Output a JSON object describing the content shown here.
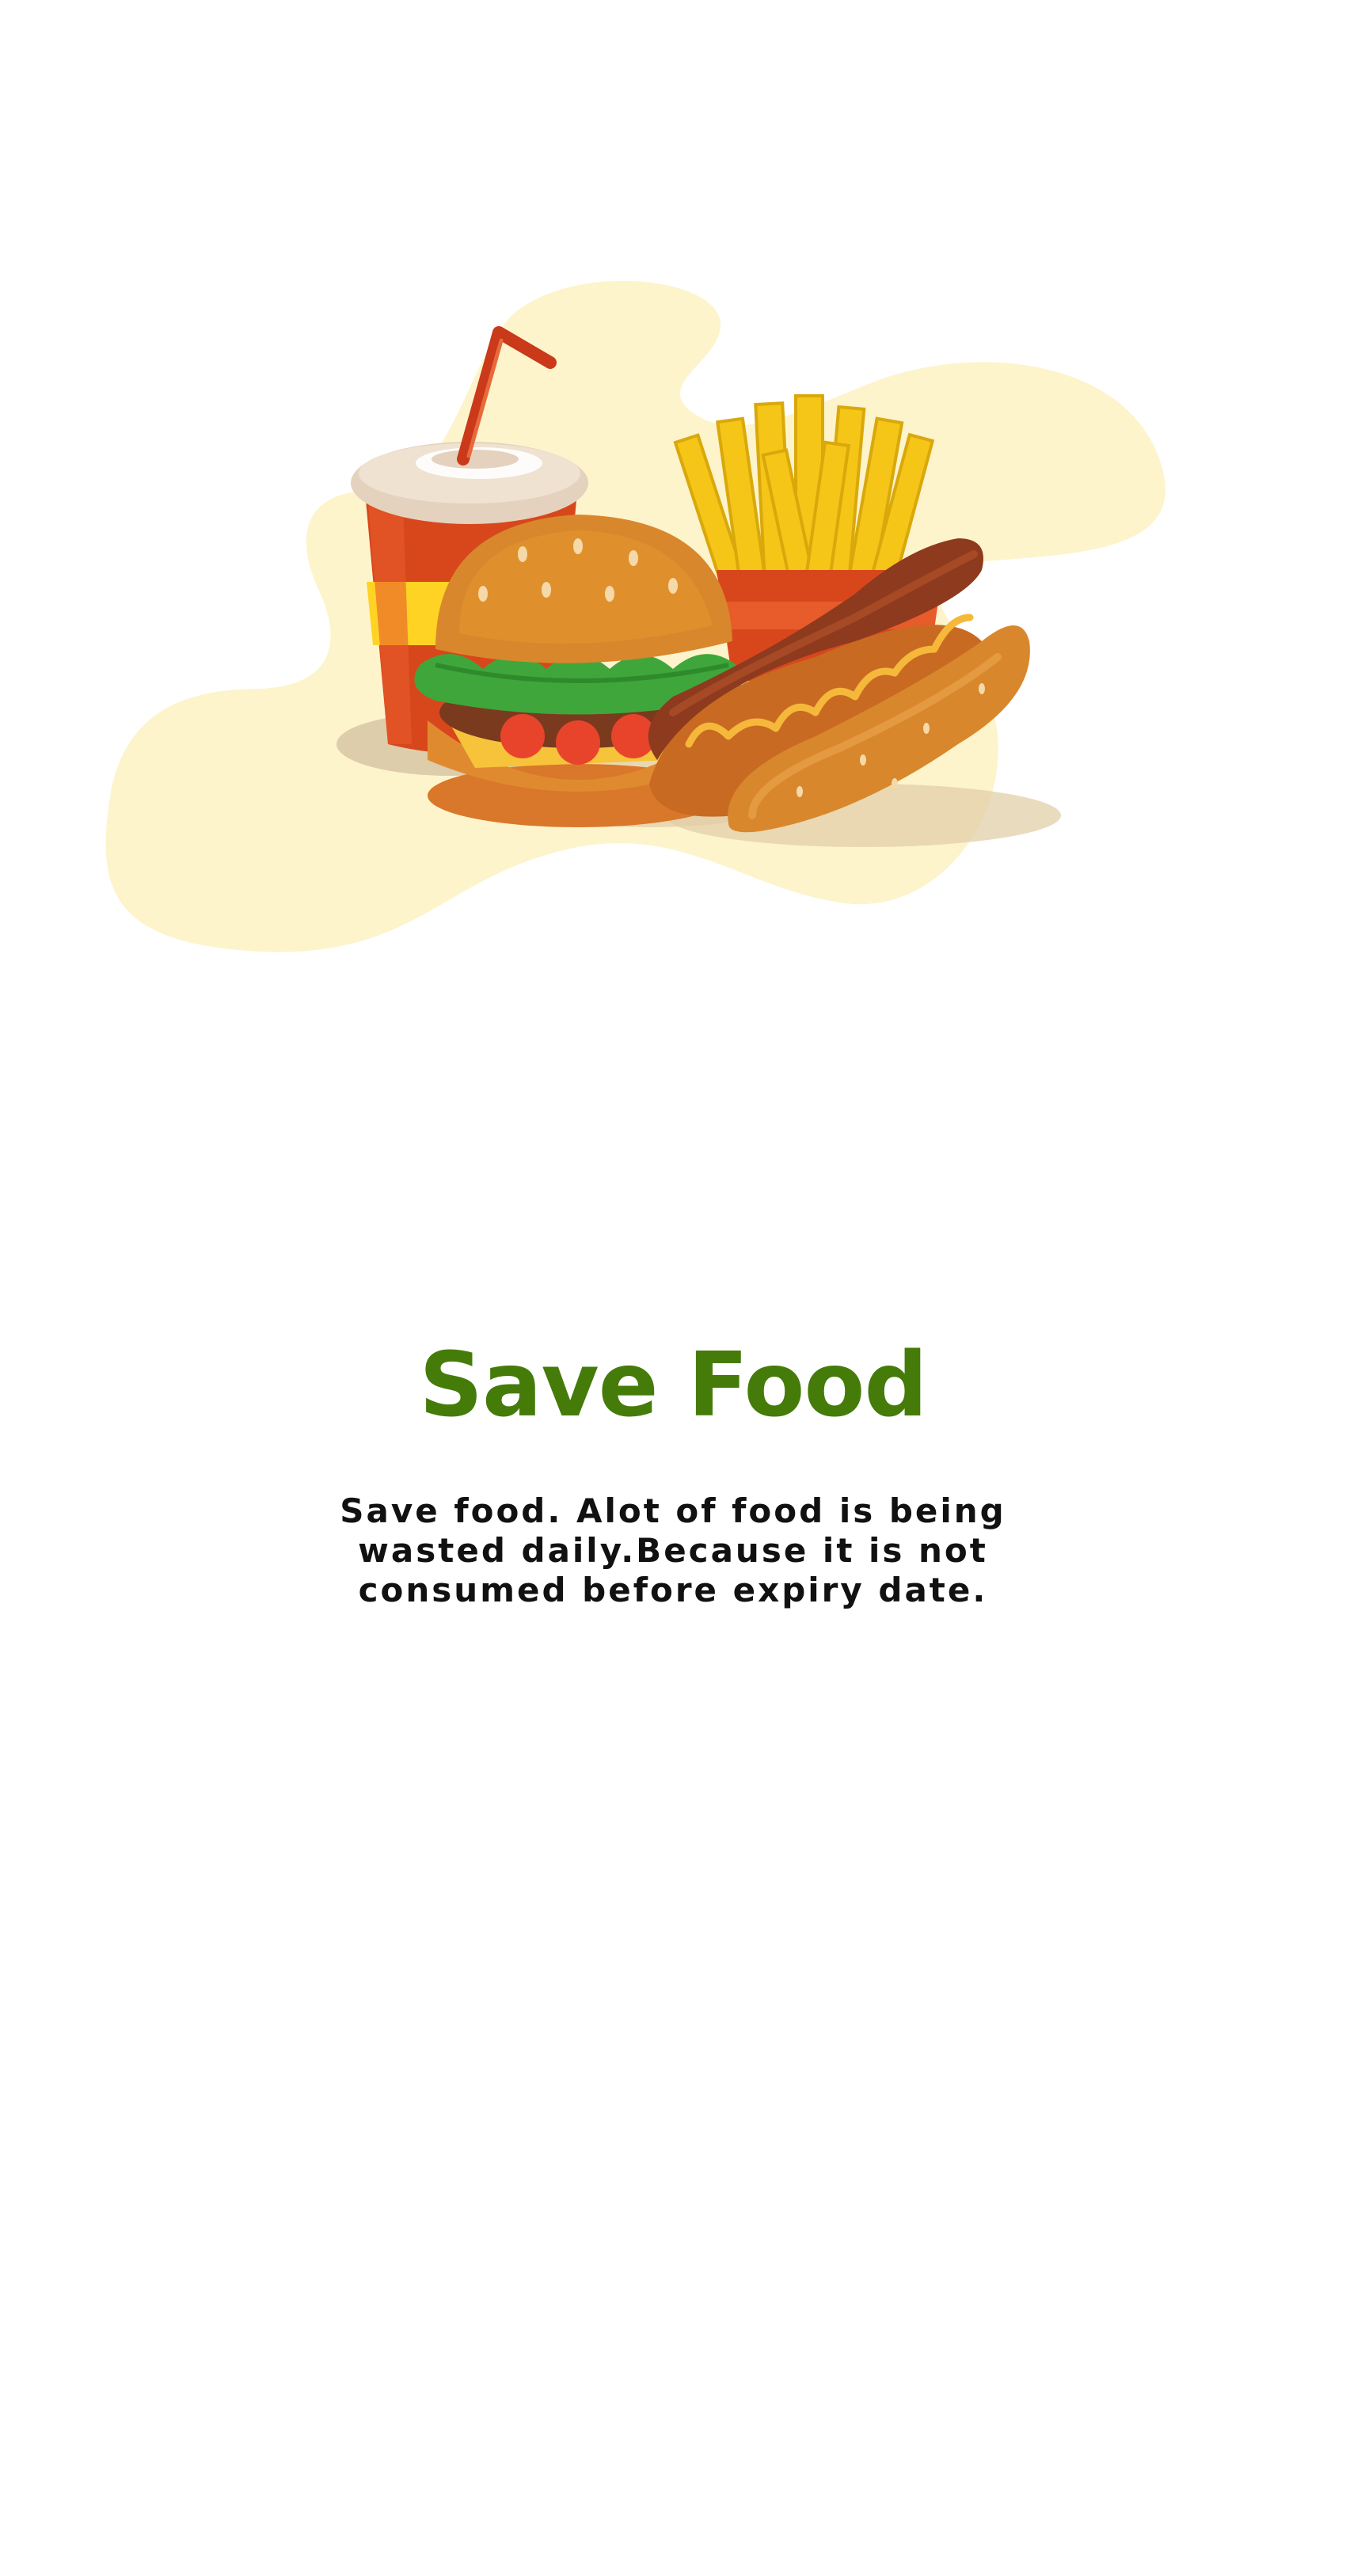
{
  "onboarding": {
    "title": "Save Food",
    "description": "Save food. Alot of food is being wasted daily.Because it is not consumed before expiry date.",
    "illustration_icon": "fast-food-illustration"
  },
  "colors": {
    "title": "#457B09",
    "text": "#111111",
    "blob": "#FDF4CC",
    "background": "#FFFFFF"
  }
}
